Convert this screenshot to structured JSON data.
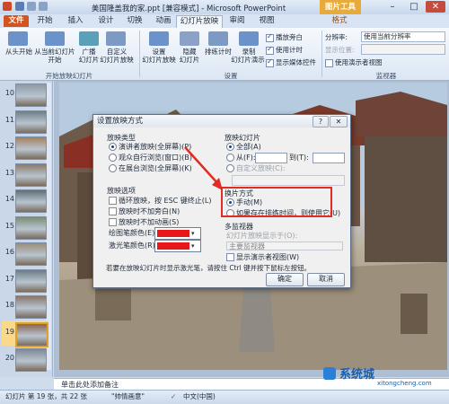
{
  "window": {
    "title": "美国隆盖我的家.ppt [兼容模式] - Microsoft PowerPoint",
    "tools_badge": "图片工具",
    "minimize": "–",
    "maximize": "□",
    "close": "✕"
  },
  "tabs": {
    "file": "文件",
    "home": "开始",
    "insert": "插入",
    "design": "设计",
    "transitions": "切换",
    "animations": "动画",
    "slideshow": "幻灯片放映",
    "review": "审阅",
    "view": "视图",
    "format": "格式"
  },
  "ribbon": {
    "from_beginning": "从头开始",
    "from_current": "从当前幻灯片",
    "from_current_2": "开始",
    "broadcast": "广播",
    "broadcast_2": "幻灯片",
    "custom": "自定义",
    "custom_2": "幻灯片放映",
    "group_start": "开始放映幻灯片",
    "setup_show": "设置",
    "setup_show_2": "幻灯片放映",
    "hide_slide": "隐藏",
    "hide_slide_2": "幻灯片",
    "rehearse": "排练计时",
    "record": "录制",
    "record_2": "幻灯片演示",
    "group_setup": "设置",
    "play_narration": "播放旁白",
    "use_timings": "使用计时",
    "show_controls": "显示媒体控件",
    "resolution_label": "分辨率:",
    "resolution_value": "使用当前分辨率",
    "show_on_label": "显示位置:",
    "show_on_value": "",
    "presenter_view": "使用演示者视图",
    "group_monitors": "监视器"
  },
  "slides": {
    "numbers": [
      "10",
      "11",
      "12",
      "13",
      "14",
      "15",
      "16",
      "17",
      "18",
      "19",
      "20"
    ],
    "selected": "19"
  },
  "dialog": {
    "title": "设置放映方式",
    "help": "?",
    "close": "✕",
    "show_type_label": "放映类型",
    "type_presenter": "演讲者放映(全屏幕)(P)",
    "type_individual": "观众自行浏览(窗口)(B)",
    "type_kiosk": "在展台浏览(全屏幕)(K)",
    "show_options_label": "放映选项",
    "opt_loop": "循环放映，按 ESC 键终止(L)",
    "opt_no_narration": "放映时不加旁白(N)",
    "opt_no_animation": "放映时不加动画(S)",
    "pen_color_label": "绘图笔颜色(E):",
    "laser_color_label": "激光笔颜色(R):",
    "pen_color": "#e81818",
    "laser_color": "#e81818",
    "show_slides_label": "放映幻灯片",
    "slides_all": "全部(A)",
    "slides_from": "从(F):",
    "slides_to": "到(T):",
    "slides_custom": "自定义放映(C):",
    "advance_label": "换片方式",
    "advance_manual": "手动(M)",
    "advance_timings": "如果存在排练时间，则使用它(U)",
    "multi_monitor_label": "多监视器",
    "display_on_label": "幻灯片放映显示于(O):",
    "display_on_value": "主要监视器",
    "presenter_view": "显示演示者视图(W)",
    "hint": "若要在放映幻灯片时显示激光笔，请按住 Ctrl 键并按下鼠标左按钮。",
    "ok": "确定",
    "cancel": "取消"
  },
  "notes_placeholder": "单击此处添加备注",
  "status": {
    "slide_info": "幻灯片 第 19 张，共 22 张",
    "theme": "\"帅情画意\"",
    "language": "中文(中国)"
  },
  "watermark": {
    "text": "系统城",
    "url": "xitongcheng.com"
  }
}
